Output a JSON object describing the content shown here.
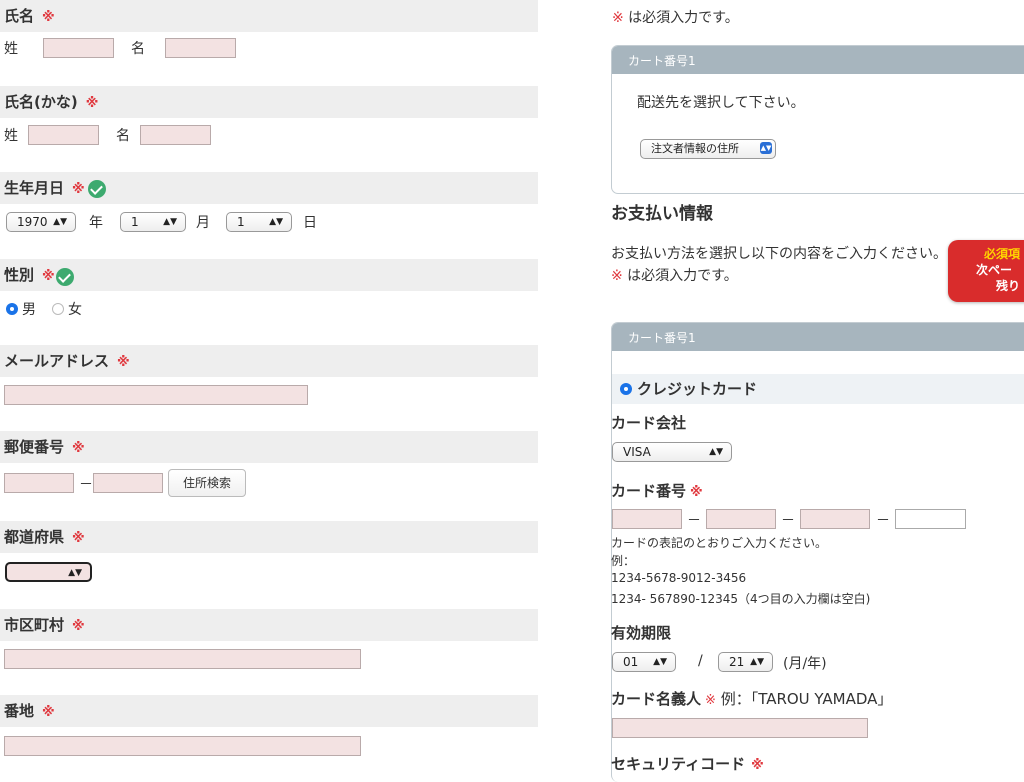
{
  "left": {
    "name": {
      "label": "氏名",
      "req": "※",
      "last_label": "姓",
      "first_label": "名"
    },
    "kana": {
      "label": "氏名(かな)",
      "req": "※",
      "last_label": "姓",
      "first_label": "名"
    },
    "birth": {
      "label": "生年月日",
      "req": "※",
      "year": "1970",
      "year_unit": "年",
      "month": "1",
      "month_unit": "月",
      "day": "1",
      "day_unit": "日"
    },
    "gender": {
      "label": "性別",
      "req": "※",
      "options": [
        "男",
        "女"
      ],
      "selected": "男"
    },
    "email": {
      "label": "メールアドレス",
      "req": "※"
    },
    "postal": {
      "label": "郵便番号",
      "req": "※",
      "sep": "－",
      "search_button": "住所検索"
    },
    "prefecture": {
      "label": "都道府県",
      "req": "※",
      "value": ""
    },
    "city": {
      "label": "市区町村",
      "req": "※"
    },
    "address": {
      "label": "番地",
      "req": "※"
    }
  },
  "right": {
    "required_note_top": {
      "mark": "※",
      "text": " は必須入力です。"
    },
    "cart1": {
      "header": "カート番号1",
      "instruction": "配送先を選択して下さい。",
      "delivery_select": "注文者情報の住所"
    },
    "payment": {
      "heading": "お支払い情報",
      "instruction": "お支払い方法を選択し以下の内容をご入力ください。",
      "required_mark": "※",
      "required_text": " は必須入力です。"
    },
    "cart2": {
      "header": "カート番号1",
      "method_label": "クレジットカード",
      "card_company_label": "カード会社",
      "card_company_value": "VISA",
      "card_number_label": "カード番号",
      "card_number_req": "※",
      "card_number_sep": "－",
      "card_note": "カードの表記のとおりご入力ください。",
      "example_label": "例：",
      "example1": "1234-5678-9012-3456",
      "example2": "1234- 567890-12345（4つ目の入力欄は空白)",
      "expiry_label": "有効期限",
      "expiry_month": "01",
      "expiry_slash": "/",
      "expiry_year": "21",
      "expiry_unit": "(月/年)",
      "holder_label": "カード名義人",
      "holder_req": "※",
      "holder_example": " 例：「TAROU YAMADA」",
      "security_label": "セキュリティコード",
      "security_req": "※"
    }
  },
  "badge": {
    "line1": "必須項",
    "line2": "次ペー",
    "line3": "残り"
  },
  "colors": {
    "required": "#e0383e",
    "input_bg": "#f3e2e2",
    "header_bg": "#eeeeee",
    "panel_head": "#a7b5be",
    "check": "#3daa6f",
    "badge": "#d92c2c"
  }
}
